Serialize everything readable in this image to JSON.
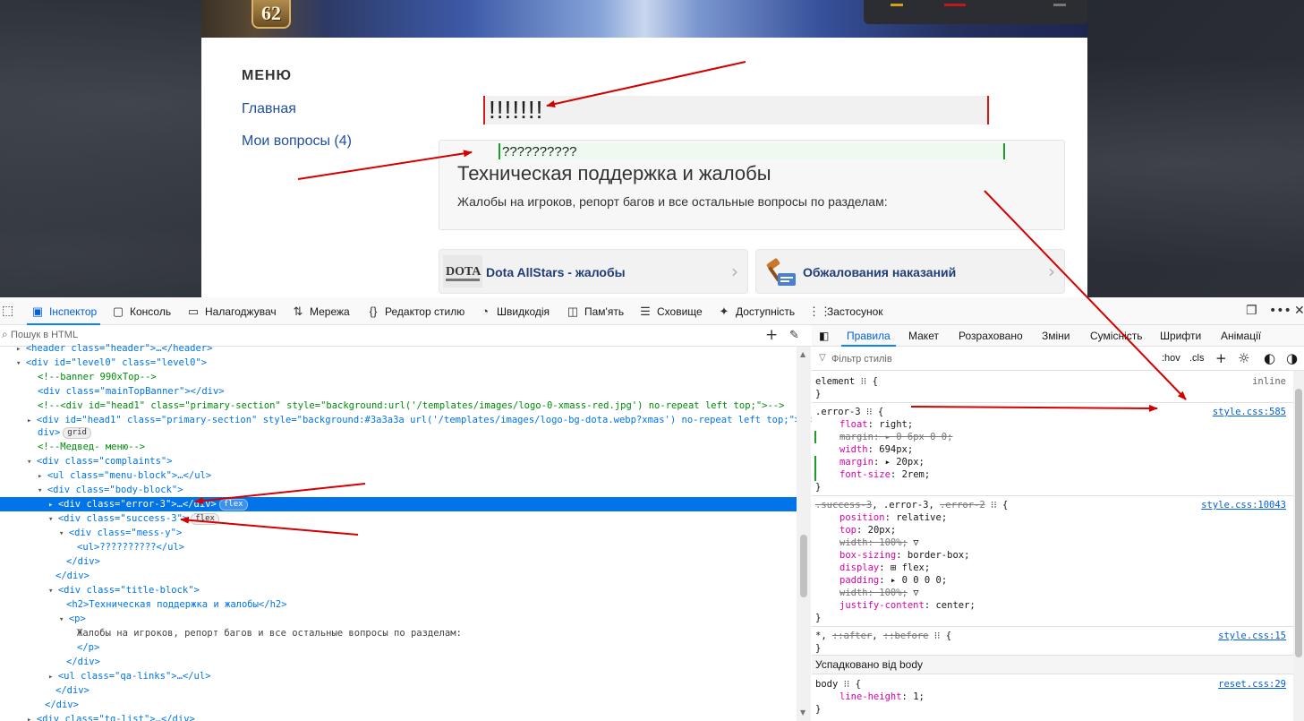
{
  "page": {
    "banner_level": "62",
    "menu_title": "МЕНЮ",
    "menu_links": [
      "Главная",
      "Мои вопросы (4)"
    ],
    "error_text": "!!!!!!!",
    "success_text": "??????????",
    "card_title": "Техническая поддержка и жалобы",
    "card_text": "Жалобы на игроков, репорт багов и все остальные вопросы по разделам:",
    "qa_links": [
      "Dota AllStars - жалобы",
      "Обжалования наказаний"
    ],
    "colors": {
      "error_bar": "#d21b1b",
      "success_bar": "#1c9c2a",
      "link": "#1f4f9e",
      "annotation": "#d40000"
    }
  },
  "devtools": {
    "tabs": [
      {
        "icon": "inspector-icon",
        "label": "Інспектор"
      },
      {
        "icon": "console-icon",
        "label": "Консоль"
      },
      {
        "icon": "debugger-icon",
        "label": "Налагоджувач"
      },
      {
        "icon": "network-icon",
        "label": "Мережа"
      },
      {
        "icon": "style-editor-icon",
        "label": "Редактор стилю"
      },
      {
        "icon": "performance-icon",
        "label": "Швидкодія"
      },
      {
        "icon": "memory-icon",
        "label": "Пам'ять"
      },
      {
        "icon": "storage-icon",
        "label": "Сховище"
      },
      {
        "icon": "accessibility-icon",
        "label": "Доступність"
      },
      {
        "icon": "application-icon",
        "label": "Застосунок"
      }
    ],
    "search_placeholder": "Пошук в HTML",
    "html_lines": [
      "<header class=\"header\">…</header>",
      "<div id=\"level0\" class=\"level0\">",
      "<!--banner 990xTop-->",
      "<div class=\"mainTopBanner\"></div>",
      "<!--<div id=\"head1\" class=\"primary-section\" style=\"background:url('/templates/images/logo-0-xmass-red.jpg') no-repeat left top;\">-->",
      "<div id=\"head1\" class=\"primary-section\" style=\"background:#3a3a3a url('/templates/images/logo-bg-dota.webp?xmas') no-repeat left top;\">…</",
      "div>",
      "<!--Медвед- меню-->",
      "<div class=\"complaints\">",
      "<ul class=\"menu-block\">…</ul>",
      "<div class=\"body-block\">",
      "<div class=\"error-3\">…</div>",
      "<div class=\"success-3\">",
      "<div class=\"mess-y\">",
      "<ul>??????????</ul>",
      "</div>",
      "</div>",
      "<div class=\"title-block\">",
      "<h2>Техническая поддержка и жалобы</h2>",
      "<p>",
      "Жалобы на игроков, репорт багов и все остальные вопросы по разделам:",
      "</p>",
      "</div>",
      "<ul class=\"qa-links\">…</ul>",
      "</div>",
      "</div>",
      "<div class=\"tg-list\">…</div>"
    ],
    "badges": {
      "grid": "grid",
      "flex": "flex",
      "ellipsis": "…"
    },
    "rules_tabs": [
      "Правила",
      "Макет",
      "Розраховано",
      "Зміни",
      "Сумісність",
      "Шрифти",
      "Анімації"
    ],
    "filter_placeholder": "Фільтр стилів",
    "filter_buttons": [
      ":hov",
      ".cls"
    ],
    "rules": [
      {
        "selector": "element",
        "source": "inline",
        "props": []
      },
      {
        "selector": ".error-3",
        "source": "style.css:585",
        "props": [
          {
            "name": "float",
            "value": "right",
            "struck": false,
            "changed": false
          },
          {
            "name": "margin",
            "value": "0 6px 0 0",
            "struck": true,
            "changed": true
          },
          {
            "name": "width",
            "value": "694px",
            "struck": false,
            "changed": false
          },
          {
            "name": "margin",
            "value": "20px",
            "struck": false,
            "changed": true
          },
          {
            "name": "font-size",
            "value": "2rem",
            "struck": false,
            "changed": true
          }
        ]
      },
      {
        "selector_parts": [
          ".success-3",
          ".error-3",
          ".error-2"
        ],
        "source": "style.css:10043",
        "props": [
          {
            "name": "position",
            "value": "relative",
            "struck": false
          },
          {
            "name": "top",
            "value": "20px",
            "struck": false
          },
          {
            "name": "width",
            "value": "100%",
            "struck": true
          },
          {
            "name": "box-sizing",
            "value": "border-box",
            "struck": false
          },
          {
            "name": "display",
            "value": "flex",
            "struck": false
          },
          {
            "name": "padding",
            "value": "0 0 0 0",
            "struck": false
          },
          {
            "name": "width",
            "value": "100%",
            "struck": true
          },
          {
            "name": "justify-content",
            "value": "center",
            "struck": false
          }
        ]
      },
      {
        "selector_parts": [
          "*",
          "::after",
          "::before"
        ],
        "source": "style.css:15",
        "props": []
      }
    ],
    "inherited_header": "Успадковано від body",
    "inherited_rule": {
      "selector": "body",
      "source": "reset.css:29",
      "props": [
        {
          "name": "line-height",
          "value": "1"
        }
      ]
    }
  }
}
